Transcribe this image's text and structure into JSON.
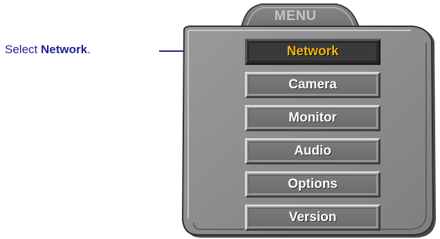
{
  "instruction": {
    "prefix": "Select ",
    "target": "Network",
    "suffix": "."
  },
  "menu": {
    "title": "MENU",
    "selected_index": 0,
    "items": [
      {
        "label": "Network"
      },
      {
        "label": "Camera"
      },
      {
        "label": "Monitor"
      },
      {
        "label": "Audio"
      },
      {
        "label": "Options"
      },
      {
        "label": "Version"
      }
    ]
  },
  "colors": {
    "caption_text": "#1f1f8f",
    "arrow": "#1f1f8f",
    "selected_label": "#f3b412",
    "button_label": "#ffffff",
    "panel": "#8c8c8c"
  }
}
